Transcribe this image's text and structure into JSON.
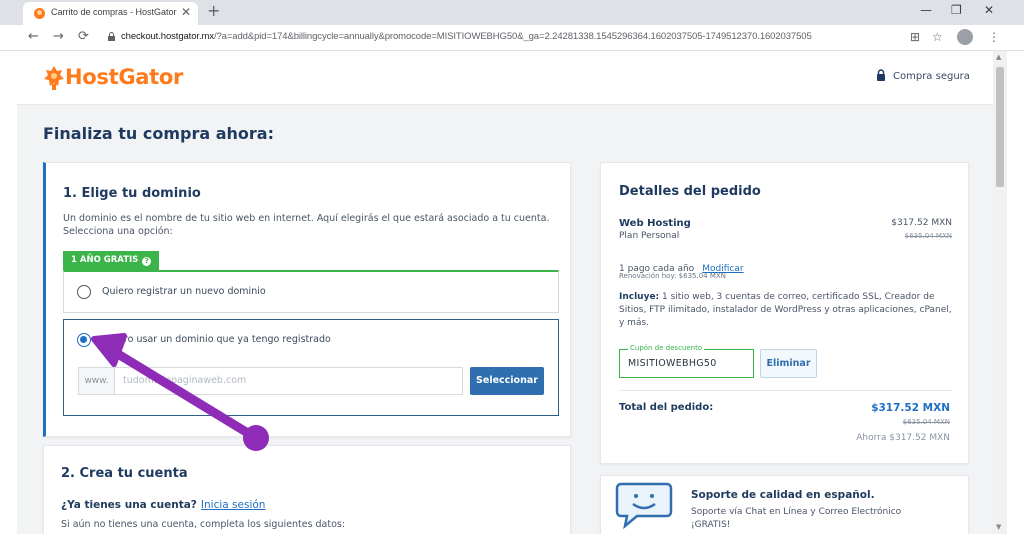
{
  "browser": {
    "tab_title": "Carrito de compras - HostGator",
    "tab_close": "✕",
    "new_tab": "+",
    "url_domain": "checkout.hostgator.mx",
    "url_path": "/?a=add&pid=174&billingcycle=annually&promocode=MISITIOWEBHG50&_ga=2.24281338.1545296364.1602037505-1749512370.1602037505",
    "back": "←",
    "forward": "→",
    "reload": "⟳",
    "minimize": "—",
    "restore": "❐",
    "close": "✕",
    "translate": "⊞",
    "bookmark": "☆",
    "menu": "⋮"
  },
  "header": {
    "logo": "HostGator",
    "secure": "Compra segura"
  },
  "page_title": "Finaliza tu compra ahora:",
  "domain": {
    "title": "1. Elige tu dominio",
    "description": "Un dominio es el nombre de tu sitio web en internet. Aquí elegirás el que estará asociado a tu cuenta. Selecciona una opción:",
    "badge": "1 AÑO GRATIS",
    "badge_icon": "?",
    "option_new": "Quiero registrar un nuevo dominio",
    "option_existing": "Quiero usar un dominio que ya tengo registrado",
    "www": "www.",
    "input_placeholder": "tudominiopaginaweb.com",
    "select_button": "Seleccionar"
  },
  "account": {
    "title": "2. Crea tu cuenta",
    "have_account": "¿Ya tienes una cuenta?",
    "login_link": "Inicia sesión",
    "subtext": "Si aún no tienes una cuenta, completa los siguientes datos:"
  },
  "order": {
    "title": "Detalles del pedido",
    "product": "Web Hosting",
    "price": "$317.52 MXN",
    "plan": "Plan Personal",
    "old_price": "$635.04 MXN",
    "cycle": "1 pago cada año",
    "modify": "Modificar",
    "renewal": "Renovación hoy: $635.04 MXN",
    "includes_label": "Incluye:",
    "includes_text": "1 sitio web, 3 cuentas de correo, certificado SSL, Creador de Sitios, FTP ilimitado, instalador de WordPress y otras aplicaciones, cPanel, y más.",
    "coupon_label": "Cupón de descuento",
    "coupon_value": "MISITIOWEBHG50",
    "remove_button": "Eliminar",
    "total_label": "Total del pedido:",
    "total_value": "$317.52 MXN",
    "total_old": "$635.04 MXN",
    "savings": "Ahorra $317.52 MXN"
  },
  "support": {
    "title": "Soporte de calidad en español.",
    "line1": "Soporte vía Chat en Línea y Correo Electrónico",
    "line2": "¡GRATIS!"
  },
  "colors": {
    "accent_orange": "#ff7a1a",
    "navy": "#1e3a5f",
    "blue": "#1e6fc2",
    "green": "#3bb449",
    "annotation_purple": "#8e2cb8"
  }
}
